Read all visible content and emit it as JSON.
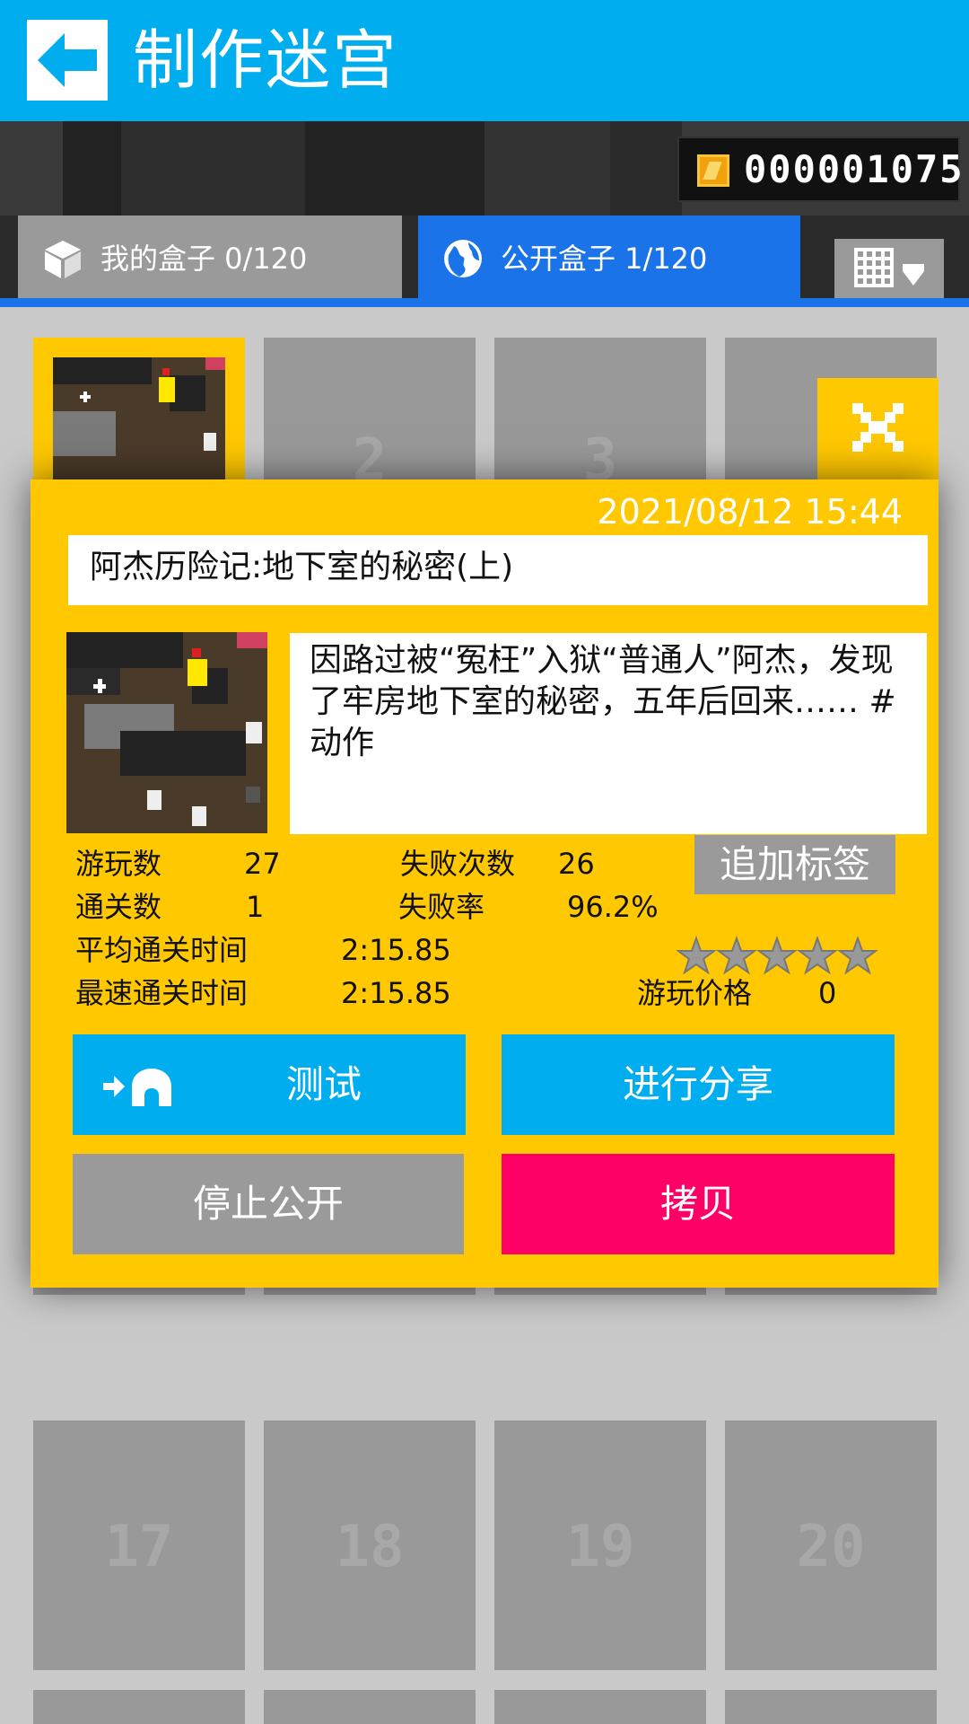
{
  "header": {
    "title": "制作迷宫",
    "back_icon": "back-arrow-icon"
  },
  "coins": {
    "value": "000001075",
    "icon": "coin-icon"
  },
  "tabs": [
    {
      "label": "我的盒子 0/120",
      "icon": "cube-icon",
      "active": false
    },
    {
      "label": "公开盒子 1/120",
      "icon": "globe-icon",
      "active": true
    }
  ],
  "grid_button": {
    "icon": "grid-view-dropdown-icon"
  },
  "grid": {
    "visible_numbers": [
      "2",
      "3",
      "17",
      "18",
      "19",
      "20"
    ]
  },
  "detail": {
    "date": "2021/08/12 15:44",
    "name": "阿杰历险记:地下室的秘密(上)",
    "description": "因路过被“冤枉”入狱“普通人”阿杰，发现了牢房地下室的秘密，五年后回来…… #动作",
    "add_tag_label": "追加标签",
    "stats": {
      "plays_label": "游玩数",
      "plays_value": "27",
      "fails_label": "失败次数",
      "fails_value": "26",
      "clears_label": "通关数",
      "clears_value": "1",
      "fail_rate_label": "失败率",
      "fail_rate_value": "96.2%",
      "avg_time_label": "平均通关时间",
      "avg_time_value": "2:15.85",
      "best_time_label": "最速通关时间",
      "best_time_value": "2:15.85",
      "price_label": "游玩价格",
      "price_value": "0"
    },
    "rating": {
      "stars_filled": 0,
      "stars_total": 5
    },
    "buttons": {
      "test": "测试",
      "share": "进行分享",
      "stop_public": "停止公开",
      "copy": "拷贝"
    }
  },
  "colors": {
    "accent_blue": "#00adee",
    "tab_blue": "#1a73e8",
    "modal_yellow": "#ffc800",
    "copy_pink": "#ff0066",
    "gray": "#9a9a9a"
  }
}
